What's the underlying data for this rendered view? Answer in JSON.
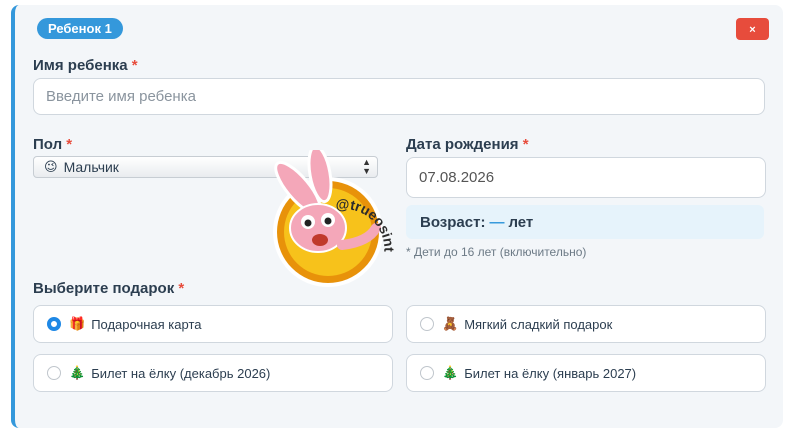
{
  "badge": "Ребенок 1",
  "close": "×",
  "name": {
    "label": "Имя ребенка",
    "required": "*",
    "placeholder": "Введите имя ребенка",
    "value": ""
  },
  "gender": {
    "label": "Пол",
    "required": "*",
    "selected_icon": "😉",
    "selected": "Мальчик"
  },
  "birth": {
    "label": "Дата рождения",
    "required": "*",
    "value": "07.08.2026"
  },
  "age": {
    "prefix": "Возраст:",
    "dash": "—",
    "suffix": "лет"
  },
  "hint": "* Дети до 16 лет (включительно)",
  "gift": {
    "label": "Выберите подарок",
    "required": "*",
    "options": [
      {
        "icon": "🎁",
        "label": "Подарочная карта",
        "selected": true
      },
      {
        "icon": "🧸",
        "label": "Мягкий сладкий подарок",
        "selected": false
      },
      {
        "icon": "🎄",
        "label": "Билет на ёлку (декабрь 2026)",
        "selected": false
      },
      {
        "icon": "🎄",
        "label": "Билет на ёлку (январь 2027)",
        "selected": false
      }
    ]
  },
  "sticker": {
    "text": "@trueosint",
    "colors": {
      "ring": "#e8920a",
      "fill": "#f7c21b",
      "bunny": "#f4a7b9"
    }
  },
  "colors": {
    "accent": "#3498db",
    "danger": "#e74c3c",
    "radio": "#1e88e5"
  }
}
